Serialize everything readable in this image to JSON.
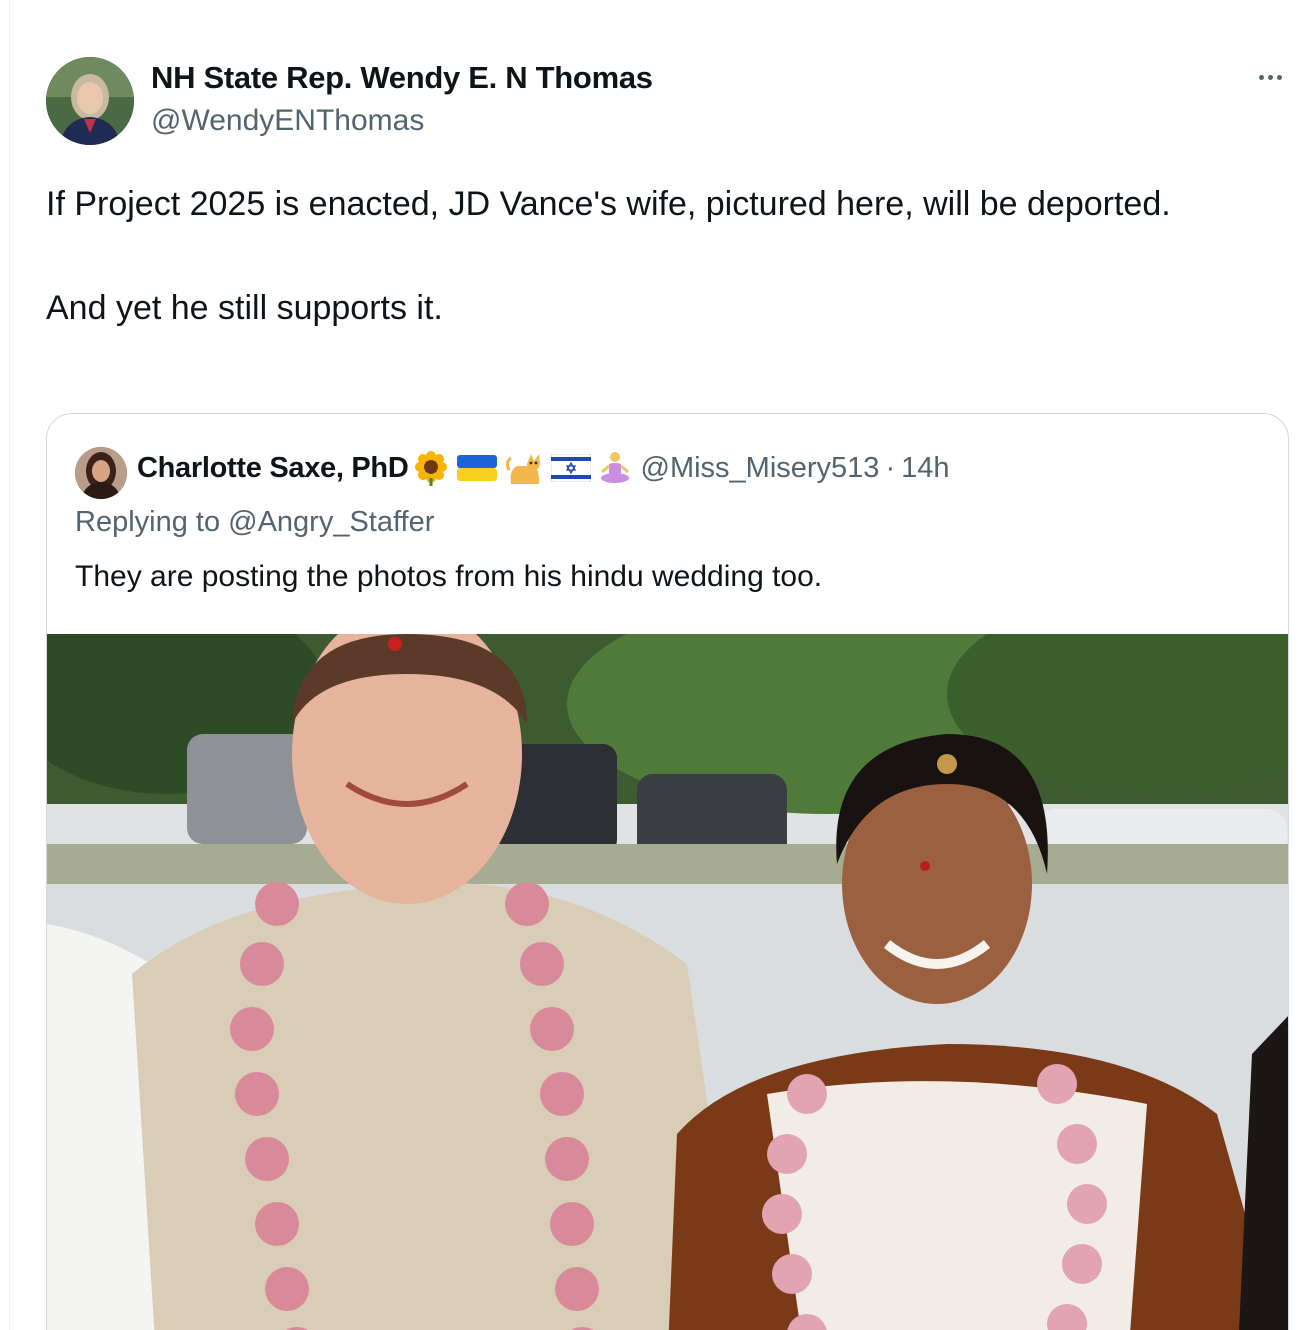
{
  "tweet": {
    "display_name": "NH State Rep. Wendy E. N Thomas",
    "handle": "@WendyENThomas",
    "text": "If Project 2025 is enacted, JD Vance's wife, pictured here, will be deported.\n\nAnd yet he still supports it.",
    "more_icon": "more-horizontal-icon"
  },
  "quoted": {
    "display_name": "Charlotte Saxe, PhD",
    "handle": "@Miss_Misery513",
    "separator": "·",
    "time": "14h",
    "replying_to": "Replying to @Angry_Staffer",
    "text": "They are posting the photos from his hindu wedding too.",
    "name_emojis": [
      "sunflower-icon",
      "ukraine-flag-icon",
      "cat-icon",
      "israel-flag-icon",
      "person-lotus-icon"
    ]
  },
  "colors": {
    "text_primary": "#0f1419",
    "text_secondary": "#536471",
    "border": "#cfd9de"
  }
}
